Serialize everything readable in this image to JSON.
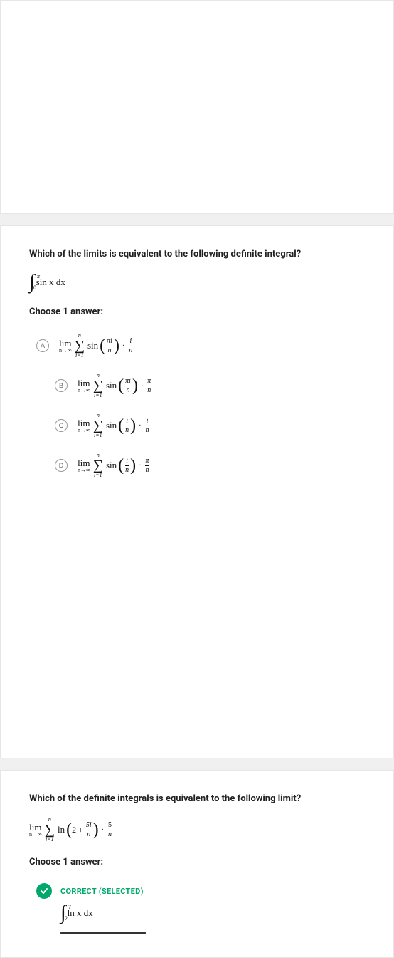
{
  "q1": {
    "question": "Which of the limits is equivalent to the following definite integral?",
    "integral": {
      "lower": "0",
      "upper": "π",
      "integrand": "sin x dx"
    },
    "choose": "Choose 1 answer:",
    "options": {
      "A": {
        "letter": "A",
        "arg_num": "πi",
        "arg_den": "n",
        "mult_num": "i",
        "mult_den": "n"
      },
      "B": {
        "letter": "B",
        "arg_num": "πi",
        "arg_den": "n",
        "mult_num": "π",
        "mult_den": "n"
      },
      "C": {
        "letter": "C",
        "arg_num": "i",
        "arg_den": "n",
        "mult_num": "i",
        "mult_den": "n"
      },
      "D": {
        "letter": "D",
        "arg_num": "i",
        "arg_den": "n",
        "mult_num": "π",
        "mult_den": "n"
      }
    },
    "common": {
      "lim_top": "lim",
      "lim_bot": "n→∞",
      "sigma_top": "n",
      "sigma_bot": "i=1",
      "func": "sin"
    }
  },
  "q2": {
    "question": "Which of the definite integrals is equivalent to the following limit?",
    "limit": {
      "lim_top": "lim",
      "lim_bot": "n→∞",
      "sigma_top": "n",
      "sigma_bot": "i=1",
      "func": "ln",
      "inner_const": "2 +",
      "inner_num": "5i",
      "inner_den": "n",
      "mult_num": "5",
      "mult_den": "n"
    },
    "choose": "Choose 1 answer:",
    "correct_label": "CORRECT (SELECTED)",
    "correct_integral": {
      "lower": "2",
      "upper": "7",
      "integrand": "ln x dx"
    }
  }
}
